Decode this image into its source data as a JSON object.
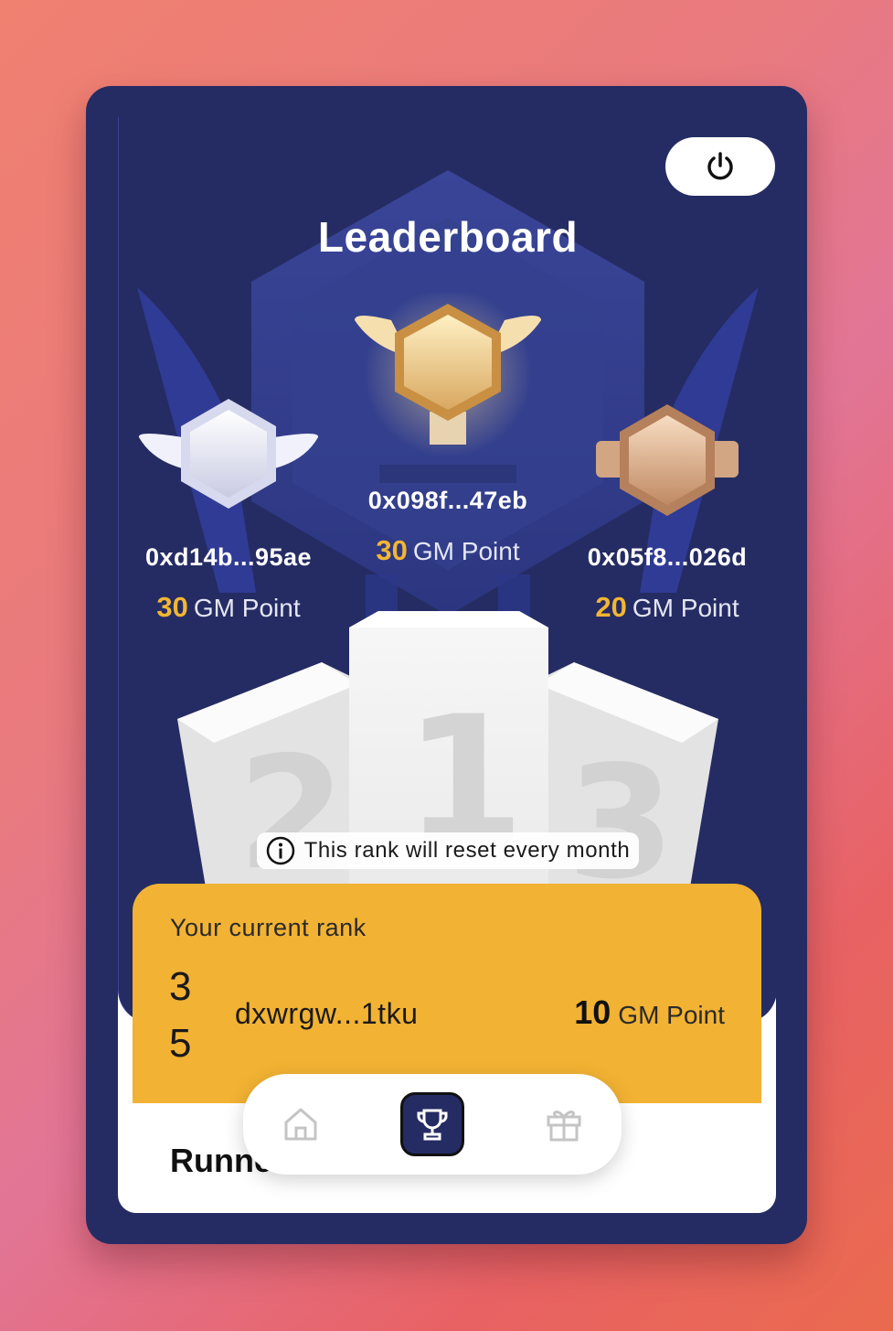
{
  "header": {
    "title": "Leaderboard",
    "power_icon": "power-icon"
  },
  "winners": [
    {
      "rank": 1,
      "address": "0x098f...47eb",
      "points": "30",
      "unit": "GM Point",
      "medal": "gold"
    },
    {
      "rank": 2,
      "address": "0xd14b...95ae",
      "points": "30",
      "unit": "GM Point",
      "medal": "silver"
    },
    {
      "rank": 3,
      "address": "0x05f8...026d",
      "points": "20",
      "unit": "GM Point",
      "medal": "bronze"
    }
  ],
  "podium": {
    "labels": [
      "2",
      "1",
      "3"
    ]
  },
  "notice": {
    "text": "This rank will reset every month",
    "icon": "info-icon"
  },
  "current_rank": {
    "label": "Your current rank",
    "rank_line1": "3",
    "rank_line2": "5",
    "user": "dxwrgw...1tku",
    "points": "10",
    "unit": "GM Point"
  },
  "section": {
    "title": "Runne"
  },
  "nav": {
    "items": [
      {
        "name": "home",
        "icon": "home-icon",
        "active": false
      },
      {
        "name": "leaderboard",
        "icon": "trophy-icon",
        "active": true
      },
      {
        "name": "rewards",
        "icon": "gift-icon",
        "active": false
      }
    ]
  },
  "colors": {
    "primary": "#252c63",
    "accent": "#f2b233",
    "points": "#f2b634"
  }
}
